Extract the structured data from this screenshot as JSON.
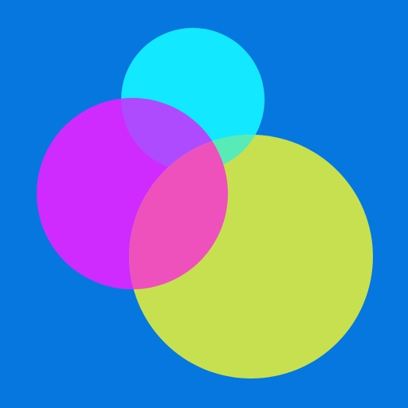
{
  "background_color": "#0677DF",
  "circles": [
    {
      "name": "cyan-circle",
      "color": "#12E8FF",
      "opacity": 0.95
    },
    {
      "name": "magenta-circle",
      "color": "#CF2BFF",
      "opacity": 0.75
    },
    {
      "name": "lime-circle",
      "color": "#C6E050",
      "opacity": 0.8
    }
  ],
  "overlap_colors": {
    "cyan-magenta": "#AE4AFF",
    "cyan-lime": "#58EBB7",
    "magenta-lime": "#EE51BC"
  }
}
